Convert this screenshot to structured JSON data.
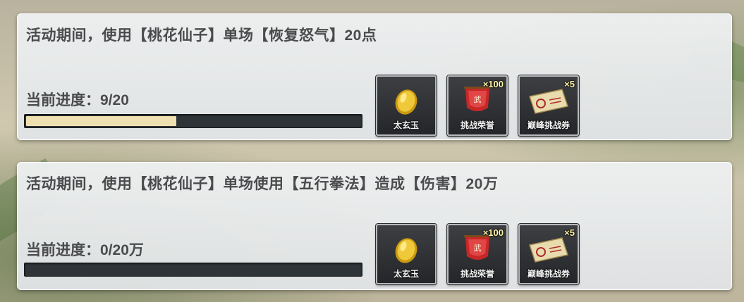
{
  "tasks": [
    {
      "description": "活动期间，使用【桃花仙子】单场【恢复怒气】20点",
      "progress_label": "当前进度：9/20",
      "progress_fraction": 0.45,
      "rewards": [
        {
          "name": "太玄玉",
          "count": "",
          "icon": "gold-jade-icon"
        },
        {
          "name": "挑战荣誉",
          "count": "×100",
          "icon": "red-banner-icon"
        },
        {
          "name": "巅峰挑战券",
          "count": "×5",
          "icon": "challenge-ticket-icon"
        }
      ]
    },
    {
      "description": "活动期间，使用【桃花仙子】单场使用【五行拳法】造成【伤害】20万",
      "progress_label": "当前进度：0/20万",
      "progress_fraction": 0,
      "rewards": [
        {
          "name": "太玄玉",
          "count": "",
          "icon": "gold-jade-icon"
        },
        {
          "name": "挑战荣誉",
          "count": "×100",
          "icon": "red-banner-icon"
        },
        {
          "name": "巅峰挑战券",
          "count": "×5",
          "icon": "challenge-ticket-icon"
        }
      ]
    }
  ],
  "colors": {
    "progress_fill": "#efe0b2",
    "progress_track": "#2f3438",
    "count_text": "#fff3a8"
  }
}
